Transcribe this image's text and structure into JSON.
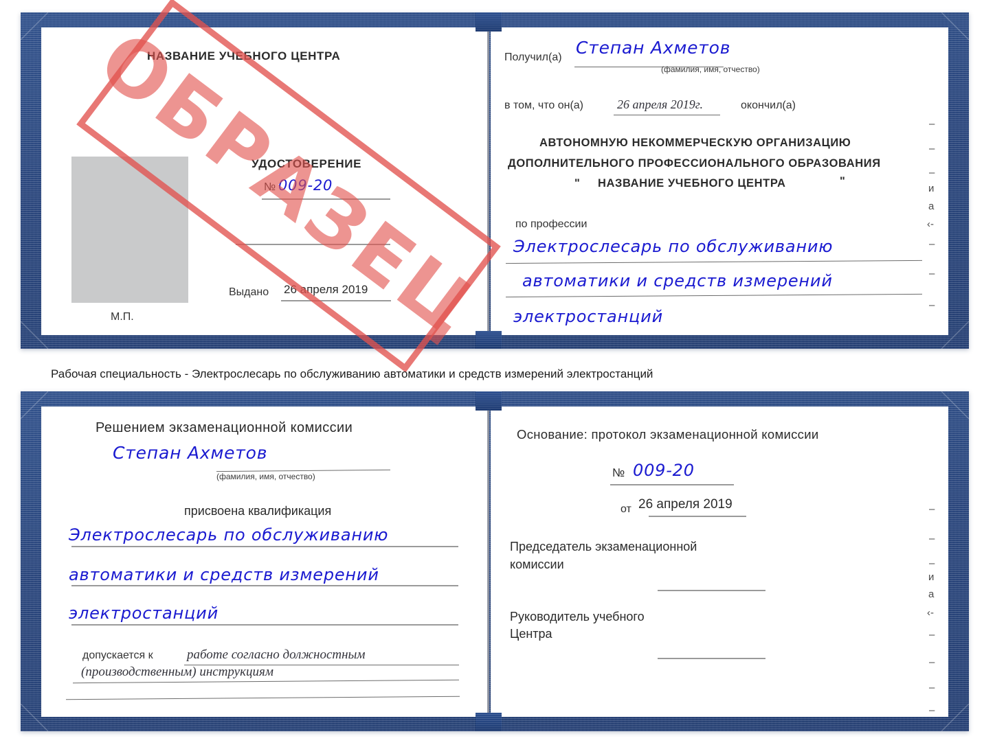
{
  "document": {
    "type": "Удостоверение",
    "watermark": "ОБРАЗЕЦ",
    "accent_blue": "#23417d",
    "ink_blue": "#1a1ad0",
    "stamp_red": "#e2524e",
    "photo_placeholder": "#c9cacb"
  },
  "caption": {
    "text": "Рабочая специальность - Электрослесарь по обслуживанию автоматики и средств измерений электростанций"
  },
  "cert_top": {
    "left_page": {
      "org_title": "НАЗВАНИЕ УЧЕБНОГО ЦЕНТРА",
      "doc_title": "УДОСТОВЕРЕНИЕ",
      "number_label": "№",
      "number_value": "009-20",
      "issued_label": "Выдано",
      "issued_value": "26 апреля 2019",
      "stamp_place": "М.П."
    },
    "right_page": {
      "received_label": "Получил(а)",
      "received_value": "Степан Ахметов",
      "fio_hint": "(фамилия, имя, отчество)",
      "that_he_label": "в том, что он(а)",
      "finished_date": "26 апреля 2019г.",
      "finished_label": "окончил(а)",
      "org_line_1": "АВТОНОМНУЮ НЕКОММЕРЧЕСКУЮ ОРГАНИЗАЦИЮ",
      "org_line_2": "ДОПОЛНИТЕЛЬНОГО ПРОФЕССИОНАЛЬНОГО ОБРАЗОВАНИЯ",
      "org_line_3_open_quote": "\"",
      "org_line_3": "НАЗВАНИЕ УЧЕБНОГО ЦЕНТРА",
      "org_line_3_close_quote": "\"",
      "profession_label": "по профессии",
      "profession_line_1": "Электрослесарь по обслуживанию",
      "profession_line_2": "автоматики и средств измерений",
      "profession_line_3": "электростанций",
      "margin_stubs": [
        "–",
        "–",
        "–",
        "и",
        "а",
        "‹-",
        "–",
        "–",
        "–"
      ]
    }
  },
  "cert_bottom": {
    "left_page": {
      "decision_title": "Решением экзаменационной комиссии",
      "name_value": "Степан Ахметов",
      "fio_hint": "(фамилия, имя, отчество)",
      "qualification_label": "присвоена квалификация",
      "qualification_line_1": "Электрослесарь по обслуживанию",
      "qualification_line_2": "автоматики и средств измерений",
      "qualification_line_3": "электростанций",
      "allowed_label": "допускается к",
      "allowed_value_1": "работе согласно должностным",
      "allowed_value_2": "(производственным) инструкциям"
    },
    "right_page": {
      "basis_label": "Основание: протокол экзаменационной комиссии",
      "protocol_number_label": "№",
      "protocol_number_value": "009-20",
      "protocol_date_label": "от",
      "protocol_date_value": "26 апреля 2019",
      "chairman_line_1": "Председатель экзаменационной",
      "chairman_line_2": "комиссии",
      "head_line_1": "Руководитель учебного",
      "head_line_2": "Центра",
      "margin_stubs": [
        "–",
        "–",
        "–",
        "и",
        "а",
        "‹-",
        "–",
        "–",
        "–",
        "–"
      ]
    }
  }
}
